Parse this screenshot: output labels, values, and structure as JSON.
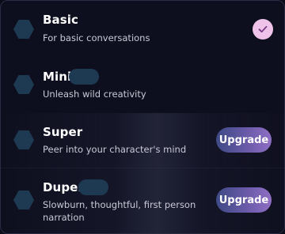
{
  "tiers": [
    {
      "name": "Basic",
      "description": "For basic conversations",
      "selected": true,
      "action": null
    },
    {
      "name": "Mini",
      "description": "Unleash wild creativity",
      "selected": false,
      "action": null
    },
    {
      "name": "Super",
      "description": "Peer into your character's mind",
      "selected": false,
      "action": "Upgrade"
    },
    {
      "name": "Duper",
      "description": "Slowburn, thoughtful, first person narration",
      "selected": false,
      "action": "Upgrade"
    }
  ],
  "icons": {
    "tier_icon": "hexagon-icon",
    "selected_icon": "checkmark-icon"
  },
  "colors": {
    "background": "#0e0f1e",
    "hexagon": "#1e3a52",
    "check_bg": "#efc2ea",
    "check_mark": "#7a3a86",
    "upgrade_start": "#3d4a86",
    "upgrade_end": "#8f6ec4"
  }
}
